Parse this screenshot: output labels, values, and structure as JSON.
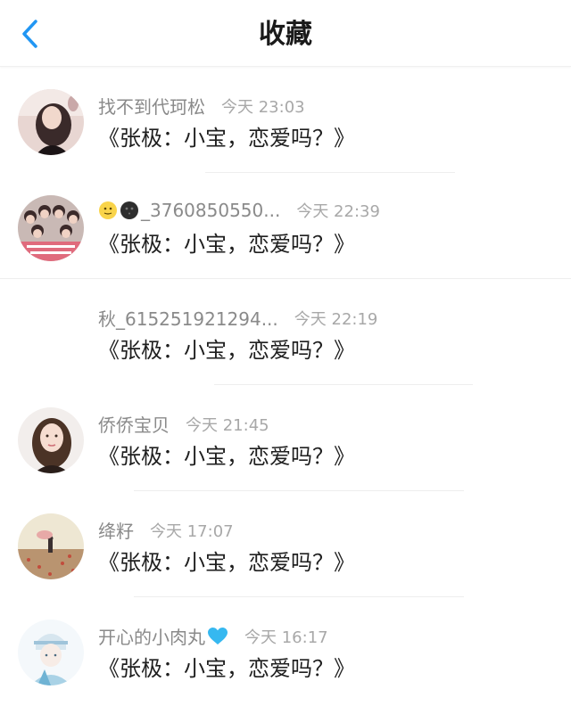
{
  "header": {
    "title": "收藏"
  },
  "items": [
    {
      "name": "找不到代珂松",
      "time": "今天 23:03",
      "message": "《张极：小宝，恋爱吗？》"
    },
    {
      "name": "_3760850550...",
      "time": "今天 22:39",
      "message": "《张极：小宝，恋爱吗？》"
    },
    {
      "name": "秋_615251921294...",
      "time": "今天 22:19",
      "message": "《张极：小宝，恋爱吗？》"
    },
    {
      "name": "侨侨宝贝",
      "time": "今天 21:45",
      "message": "《张极：小宝，恋爱吗？》"
    },
    {
      "name": "绛籽",
      "time": "今天 17:07",
      "message": "《张极：小宝，恋爱吗？》"
    },
    {
      "name": "开心的小肉丸",
      "time": "今天 16:17",
      "message": "《张极：小宝，恋爱吗？》"
    }
  ],
  "colors": {
    "accent": "#2196f3",
    "heart": "#36b8f0",
    "name": "#8a8a8a",
    "time": "#a8a8a8"
  },
  "icons": {
    "back": "chevron-left-icon",
    "heart": "heart-icon"
  }
}
